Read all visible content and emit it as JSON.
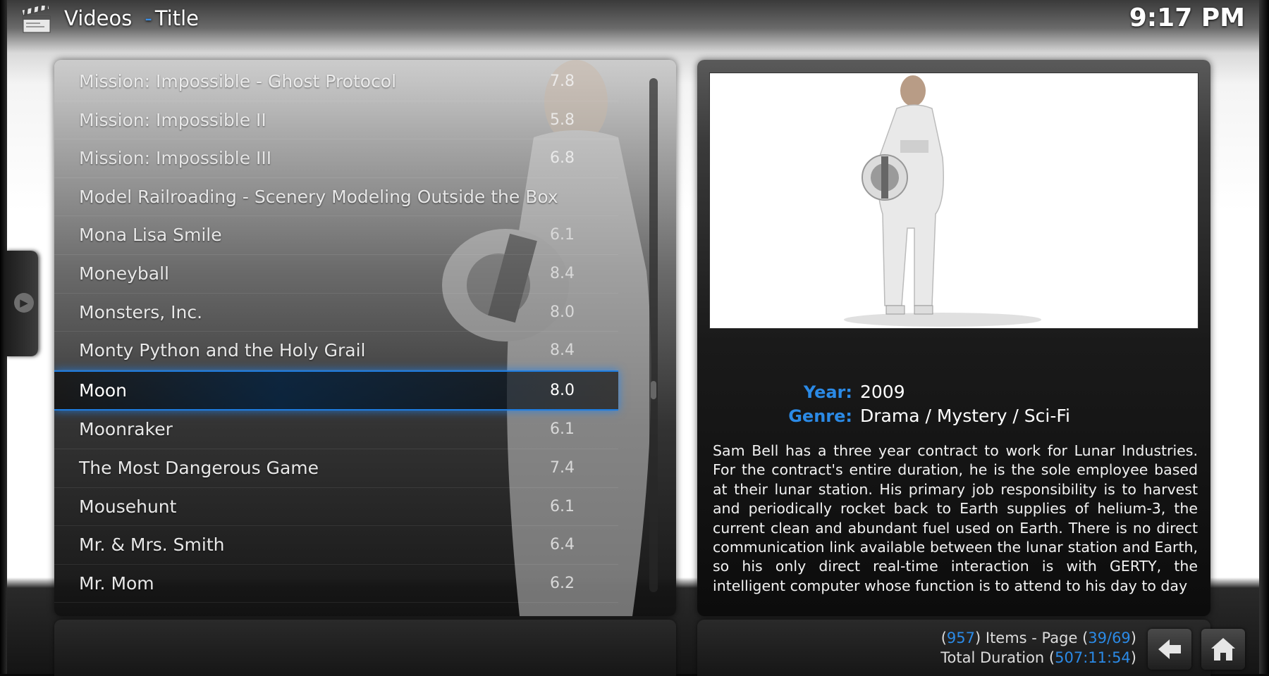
{
  "header": {
    "section": "Videos",
    "separator": "-",
    "view": "Title",
    "clock": "9:17 PM"
  },
  "list": {
    "items": [
      {
        "title": "Mission: Impossible - Ghost Protocol",
        "rating": "7.8"
      },
      {
        "title": "Mission: Impossible II",
        "rating": "5.8"
      },
      {
        "title": "Mission: Impossible III",
        "rating": "6.8"
      },
      {
        "title": "Model Railroading - Scenery Modeling Outside the Box",
        "rating": ""
      },
      {
        "title": "Mona Lisa Smile",
        "rating": "6.1"
      },
      {
        "title": "Moneyball",
        "rating": "8.4"
      },
      {
        "title": "Monsters, Inc.",
        "rating": "8.0"
      },
      {
        "title": "Monty Python and the Holy Grail",
        "rating": "8.4"
      },
      {
        "title": "Moon",
        "rating": "8.0"
      },
      {
        "title": "Moonraker",
        "rating": "6.1"
      },
      {
        "title": "The Most Dangerous Game",
        "rating": "7.4"
      },
      {
        "title": "Mousehunt",
        "rating": "6.1"
      },
      {
        "title": "Mr. & Mrs. Smith",
        "rating": "6.4"
      },
      {
        "title": "Mr. Mom",
        "rating": "6.2"
      }
    ],
    "selected_index": 8
  },
  "info": {
    "year_label": "Year:",
    "year": "2009",
    "genre_label": "Genre:",
    "genre": "Drama / Mystery / Sci-Fi",
    "plot": "Sam Bell has a three year contract to work for Lunar Industries. For the contract's entire duration, he is the sole employee based at their lunar station. His primary job responsibility is to harvest and periodically rocket back to Earth supplies of helium-3, the current clean and abundant fuel used on Earth. There is no direct communication link available between the lunar station and Earth, so his only direct real-time interaction is with GERTY, the intelligent computer whose function is to attend to his day to day"
  },
  "footer": {
    "items_count": "957",
    "items_label": "Items - Page",
    "page": "39/69",
    "duration_label": "Total Duration",
    "duration": "507:11:54"
  },
  "icons": {
    "clapper": "clapperboard-icon",
    "back": "back-arrow-icon",
    "home": "home-icon",
    "side": "side-menu-arrow-icon"
  },
  "colors": {
    "accent": "#2b8ae6",
    "selection_glow": "#1f7de0"
  }
}
